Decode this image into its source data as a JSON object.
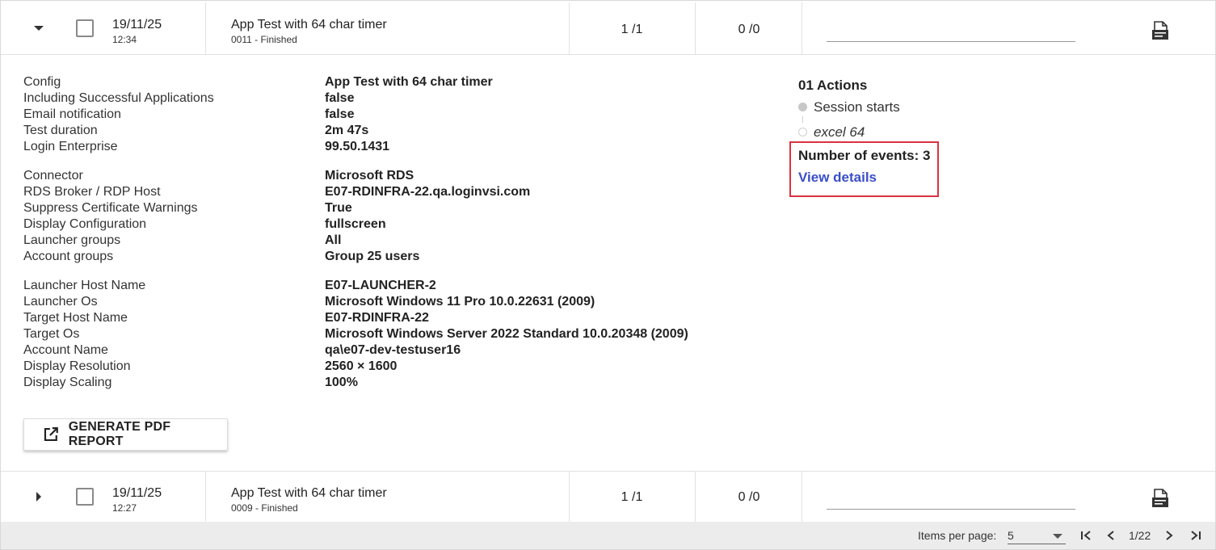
{
  "rows": [
    {
      "date": "19/11/25",
      "time": "12:34",
      "name": "App Test with 64 char timer",
      "status": "0011 - Finished",
      "col_a": "1 /1",
      "col_b": "0 /0",
      "expanded": true
    },
    {
      "date": "19/11/25",
      "time": "12:27",
      "name": "App Test with 64 char timer",
      "status": "0009 - Finished",
      "col_a": "1 /1",
      "col_b": "0 /0",
      "expanded": false
    }
  ],
  "details": {
    "group1": [
      {
        "key": "Config",
        "value": "App Test with 64 char timer"
      },
      {
        "key": "Including Successful Applications",
        "value": "false"
      },
      {
        "key": "Email notification",
        "value": "false"
      },
      {
        "key": "Test duration",
        "value": "2m 47s"
      },
      {
        "key": "Login Enterprise",
        "value": "99.50.1431"
      }
    ],
    "group2": [
      {
        "key": "Connector",
        "value": "Microsoft RDS"
      },
      {
        "key": "RDS Broker / RDP Host",
        "value": "E07-RDINFRA-22.qa.loginvsi.com"
      },
      {
        "key": "Suppress Certificate Warnings",
        "value": "True"
      },
      {
        "key": "Display Configuration",
        "value": "fullscreen"
      },
      {
        "key": "Launcher groups",
        "value": "All"
      },
      {
        "key": "Account groups",
        "value": "Group 25 users"
      }
    ],
    "group3": [
      {
        "key": "Launcher Host Name",
        "value": "E07-LAUNCHER-2"
      },
      {
        "key": "Launcher Os",
        "value": "Microsoft Windows 11 Pro 10.0.22631 (2009)"
      },
      {
        "key": "Target Host Name",
        "value": "E07-RDINFRA-22"
      },
      {
        "key": "Target Os",
        "value": "Microsoft Windows Server 2022 Standard 10.0.20348 (2009)"
      },
      {
        "key": "Account Name",
        "value": "qa\\e07-dev-testuser16"
      },
      {
        "key": "Display Resolution",
        "value": "2560 × 1600"
      },
      {
        "key": "Display Scaling",
        "value": "100%"
      }
    ]
  },
  "actions": {
    "title": "01 Actions",
    "steps": [
      "Session starts",
      "excel 64"
    ],
    "events_label": "Number of events: 3",
    "view_details": "View details"
  },
  "generate_button": "GENERATE PDF REPORT",
  "footer": {
    "items_per_page_label": "Items per page:",
    "items_per_page_value": "5",
    "page_label": "1/22"
  },
  "colors": {
    "highlight": "#d9323f",
    "link": "#3a4fc7"
  }
}
